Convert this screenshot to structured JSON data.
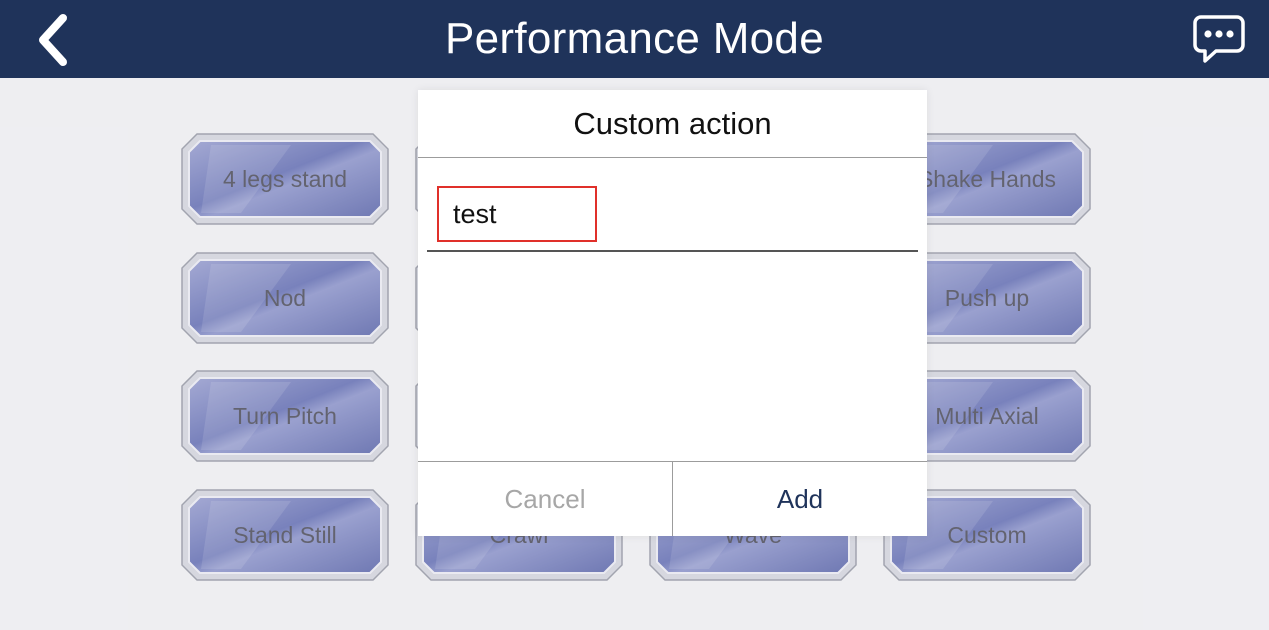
{
  "header": {
    "title": "Performance Mode",
    "back_icon": "chevron-left-icon",
    "chat_icon": "chat-bubble-icon"
  },
  "actions": [
    {
      "label": "4 legs stand"
    },
    {
      "label": ""
    },
    {
      "label": ""
    },
    {
      "label": "Shake Hands"
    },
    {
      "label": "Nod"
    },
    {
      "label": ""
    },
    {
      "label": ""
    },
    {
      "label": "Push up"
    },
    {
      "label": "Turn Pitch"
    },
    {
      "label": ""
    },
    {
      "label": ""
    },
    {
      "label": "Multi Axial"
    },
    {
      "label": "Stand Still"
    },
    {
      "label": "Crawl"
    },
    {
      "label": "Wave"
    },
    {
      "label": "Custom"
    }
  ],
  "dialog": {
    "title": "Custom action",
    "input_value": "test",
    "cancel_label": "Cancel",
    "add_label": "Add"
  },
  "colors": {
    "header_bg": "#1f335a",
    "button_face": "#3a48a0",
    "highlight": "#e0302a"
  }
}
